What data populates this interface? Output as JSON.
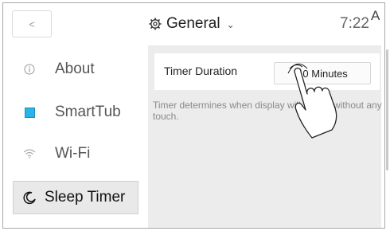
{
  "header": {
    "back_label": "<",
    "title": "General",
    "time": "7:22",
    "status_letter": "A"
  },
  "sidebar": {
    "items": [
      {
        "label": "About",
        "icon": "info-icon"
      },
      {
        "label": "SmartTub",
        "icon": "smarttub-square-icon",
        "color": "#29b6e6"
      },
      {
        "label": "Wi-Fi",
        "icon": "wifi-icon"
      },
      {
        "label": "Sleep Timer",
        "icon": "moon-icon",
        "active": true
      }
    ]
  },
  "main": {
    "setting": {
      "label": "Timer Duration",
      "value": "10 Minutes"
    },
    "description": "Timer determines when display will sleeps without any touch."
  },
  "colors": {
    "panel_bg": "#ececec",
    "active_bg": "#e9e9e9",
    "accent": "#29b6e6"
  }
}
